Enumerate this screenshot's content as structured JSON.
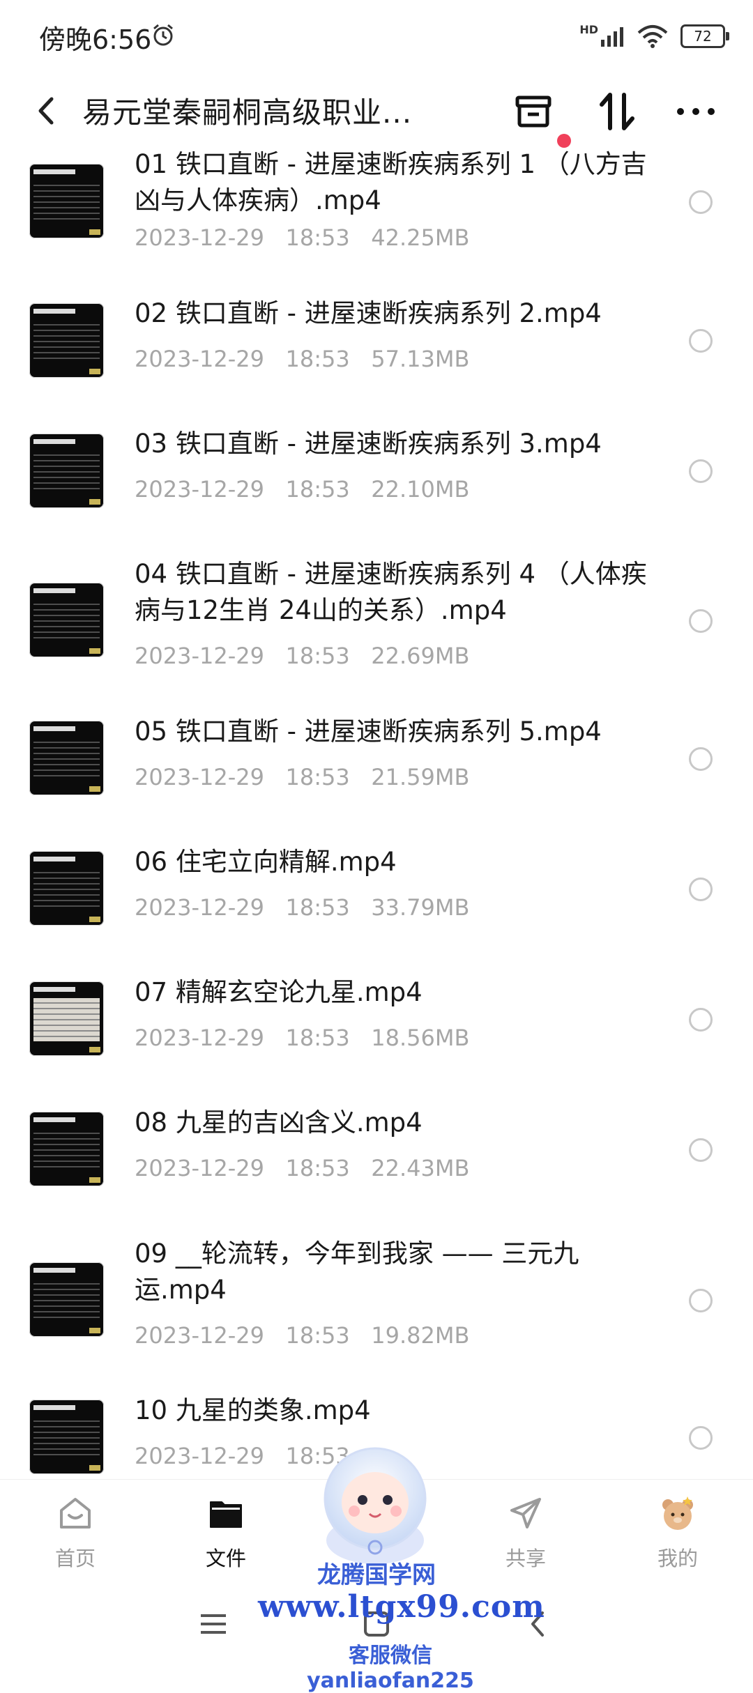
{
  "status_bar": {
    "time": "傍晚6:56",
    "network": "HD",
    "battery": "72"
  },
  "header": {
    "title": "易元堂秦嗣桐高级职业...",
    "has_notification_dot": true
  },
  "files": [
    {
      "name": "01 铁口直断 - 进屋速断疾病系列 1 （八方吉凶与人体疾病）.mp4",
      "date": "2023-12-29",
      "time": "18:53",
      "size": "42.25MB"
    },
    {
      "name": "02 铁口直断 - 进屋速断疾病系列 2.mp4",
      "date": "2023-12-29",
      "time": "18:53",
      "size": "57.13MB"
    },
    {
      "name": "03 铁口直断 - 进屋速断疾病系列 3.mp4",
      "date": "2023-12-29",
      "time": "18:53",
      "size": "22.10MB"
    },
    {
      "name": "04 铁口直断 - 进屋速断疾病系列 4 （人体疾病与12生肖 24山的关系）.mp4",
      "date": "2023-12-29",
      "time": "18:53",
      "size": "22.69MB"
    },
    {
      "name": "05 铁口直断 - 进屋速断疾病系列 5.mp4",
      "date": "2023-12-29",
      "time": "18:53",
      "size": "21.59MB"
    },
    {
      "name": "06 住宅立向精解.mp4",
      "date": "2023-12-29",
      "time": "18:53",
      "size": "33.79MB"
    },
    {
      "name": "07 精解玄空论九星.mp4",
      "date": "2023-12-29",
      "time": "18:53",
      "size": "18.56MB"
    },
    {
      "name": "08 九星的吉凶含义.mp4",
      "date": "2023-12-29",
      "time": "18:53",
      "size": "22.43MB"
    },
    {
      "name": "09 __轮流转，今年到我家 —— 三元九运.mp4",
      "date": "2023-12-29",
      "time": "18:53",
      "size": "19.82MB"
    },
    {
      "name": "10 九星的类象.mp4",
      "date": "2023-12-29",
      "time": "18:53",
      "size": ""
    }
  ],
  "bottom_nav": [
    {
      "label": "首页",
      "icon": "home-icon",
      "active": false
    },
    {
      "label": "文件",
      "icon": "folder-icon",
      "active": true
    },
    {
      "label": "",
      "icon": "mascot",
      "active": false
    },
    {
      "label": "共享",
      "icon": "share-icon",
      "active": false
    },
    {
      "label": "我的",
      "icon": "profile-icon",
      "active": false
    }
  ],
  "watermark": {
    "name": "龙腾国学网",
    "url": "www.ltgx99.com",
    "wechat": "客服微信 yanliaofan225"
  },
  "colors": {
    "accent_dot": "#f0405a",
    "meta_text": "#a6a6a6",
    "watermark": "#2b4fd1"
  }
}
